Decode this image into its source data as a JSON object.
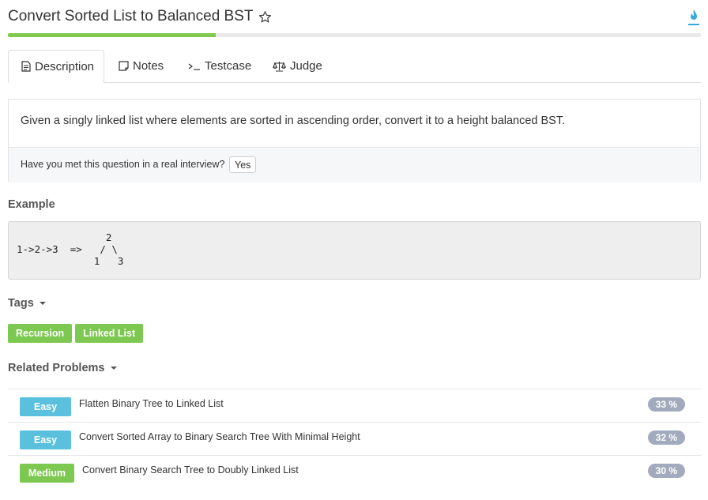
{
  "header": {
    "title": "Convert Sorted List to Balanced BST",
    "progress": 0.3
  },
  "tabs": [
    {
      "label": "Description",
      "icon": "document-icon",
      "active": true
    },
    {
      "label": "Notes",
      "icon": "note-icon"
    },
    {
      "label": "Testcase",
      "icon": "terminal-icon"
    },
    {
      "label": "Judge",
      "icon": "scale-icon"
    }
  ],
  "description": {
    "text": "Given a singly linked list where elements are sorted in ascending order, convert it to a height balanced BST.",
    "interview_question": "Have you met this question in a real interview?",
    "yes_label": "Yes"
  },
  "example": {
    "heading": "Example",
    "code": "               2\n1->2->3  =>   / \\\n             1   3"
  },
  "tags": {
    "heading": "Tags",
    "items": [
      "Recursion",
      "Linked List"
    ]
  },
  "related": {
    "heading": "Related Problems",
    "items": [
      {
        "difficulty": "Easy",
        "title": "Flatten Binary Tree to Linked List",
        "percent": "33 %"
      },
      {
        "difficulty": "Easy",
        "title": "Convert Sorted Array to Binary Search Tree With Minimal Height",
        "percent": "32 %"
      },
      {
        "difficulty": "Medium",
        "title": "Convert Binary Search Tree to Doubly Linked List",
        "percent": "30 %"
      }
    ]
  },
  "colors": {
    "accent_green": "#7dc850",
    "easy_blue": "#5bc0de",
    "percent_badge": "#a2abbd",
    "flame_blue": "#39a9e0"
  }
}
